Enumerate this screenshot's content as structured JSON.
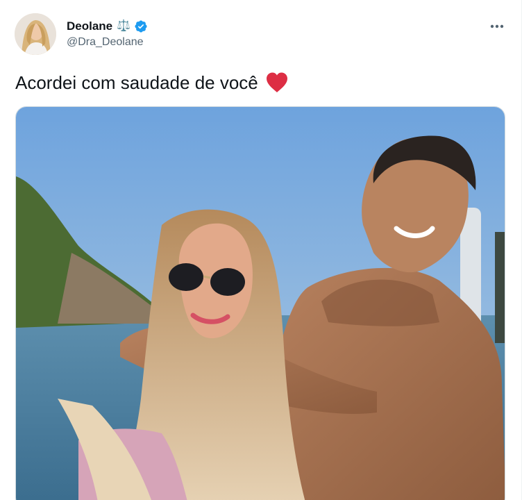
{
  "tweet": {
    "author": {
      "display_name": "Deolane",
      "handle": "@Dra_Deolane",
      "name_emoji": "⚖️",
      "verified": true
    },
    "text": "Acordei com saudade de você",
    "text_emoji": "heart",
    "more_label": "•••",
    "media_icon": "photo"
  },
  "colors": {
    "verified_badge": "#1d9bf0",
    "heart": "#dd2e44",
    "handle_text": "#536471",
    "primary_text": "#0f1419"
  }
}
